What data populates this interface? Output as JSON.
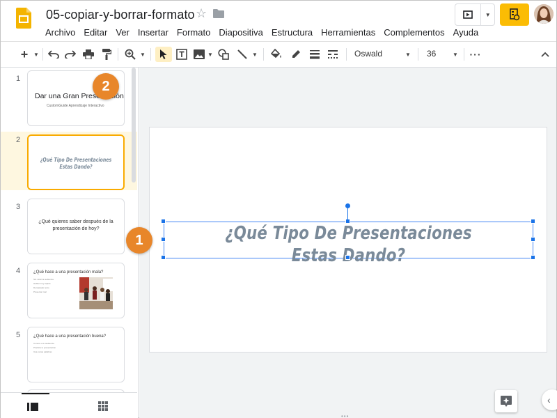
{
  "app": {
    "doc_title": "05-copiar-y-borrar-formato",
    "menus": [
      "Archivo",
      "Editar",
      "Ver",
      "Insertar",
      "Formato",
      "Diapositiva",
      "Estructura",
      "Herramientas",
      "Complementos",
      "Ayuda"
    ]
  },
  "toolbar": {
    "font_name": "Oswald",
    "font_size": "36",
    "icons": [
      "add-icon",
      "undo-icon",
      "redo-icon",
      "print-icon",
      "paint-format-icon",
      "zoom-icon",
      "select-icon",
      "textbox-icon",
      "image-icon",
      "shape-icon",
      "line-icon",
      "fill-color-icon",
      "border-color-icon",
      "border-weight-icon",
      "border-dash-icon",
      "more-icon",
      "collapse-icon"
    ]
  },
  "filmstrip": {
    "slides": [
      {
        "number": "1",
        "title": "Dar una Gran Presentación",
        "subtitle": "CustomGuide Aprendizaje Interactivo"
      },
      {
        "number": "2",
        "title_line1": "¿Qué Tipo De Presentaciones",
        "title_line2": "Estas Dando?"
      },
      {
        "number": "3",
        "title": "¿Qué quieres saber después de la presentación de hoy?"
      },
      {
        "number": "4",
        "title": "¿Qué hace a una presentación mala?",
        "bullets": [
          "Sin mirar la audiencia",
          "Hablar muy rápido",
          "Demasiado texto",
          "Presentar mal"
        ]
      },
      {
        "number": "5",
        "title": "¿Qué hace a una presentación buena?",
        "bullets": [
          "Conoce a tu audiencia",
          "Practica tu presentación",
          "Usa pocas palabras"
        ]
      }
    ]
  },
  "slide": {
    "text_line1": "¿Qué Tipo De Presentaciones",
    "text_line2": "Estas Dando?",
    "text_color": "#7a8a99"
  },
  "callouts": {
    "one": "1",
    "two": "2",
    "color": "#e8862a"
  },
  "colors": {
    "accent": "#f9ab00",
    "selection": "#1a73e8",
    "share": "#fbbc04"
  }
}
